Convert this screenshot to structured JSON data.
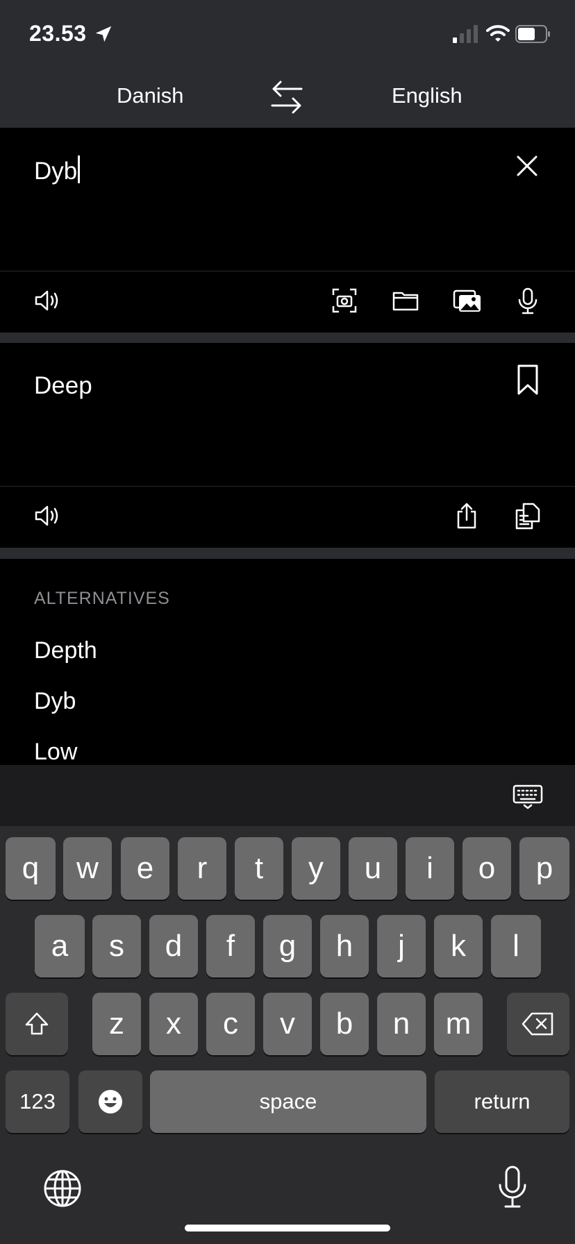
{
  "status_bar": {
    "time": "23.53",
    "icons": [
      "location-arrow-icon",
      "cellular-signal-icon",
      "wifi-icon",
      "battery-icon"
    ]
  },
  "language_bar": {
    "source": "Danish",
    "target": "English",
    "swap_icon": "swap-arrows-icon"
  },
  "input": {
    "text": "Dyb",
    "icons": [
      "clear-icon",
      "speaker-icon",
      "camera-scan-icon",
      "folder-icon",
      "photos-icon",
      "microphone-icon"
    ]
  },
  "output": {
    "text": "Deep",
    "icons": [
      "bookmark-icon",
      "speaker-icon",
      "share-icon",
      "copy-icon"
    ]
  },
  "alternatives": {
    "heading": "ALTERNATIVES",
    "items": [
      "Depth",
      "Dyb",
      "Low"
    ]
  },
  "keyboard": {
    "row1": [
      "q",
      "w",
      "e",
      "r",
      "t",
      "y",
      "u",
      "i",
      "o",
      "p"
    ],
    "row2": [
      "a",
      "s",
      "d",
      "f",
      "g",
      "h",
      "j",
      "k",
      "l"
    ],
    "row3": [
      "z",
      "x",
      "c",
      "v",
      "b",
      "n",
      "m"
    ],
    "numbers_label": "123",
    "space_label": "space",
    "return_label": "return",
    "icons": [
      "keyboard-hide-icon",
      "shift-icon",
      "delete-icon",
      "emoji-icon",
      "globe-icon",
      "dictation-icon"
    ]
  },
  "colors": {
    "bar_background": "#2a2c30",
    "panel_background": "#000000",
    "key_background": "#6b6b6b",
    "key_dark_background": "#464646",
    "secondary_text": "#8e8e93"
  }
}
